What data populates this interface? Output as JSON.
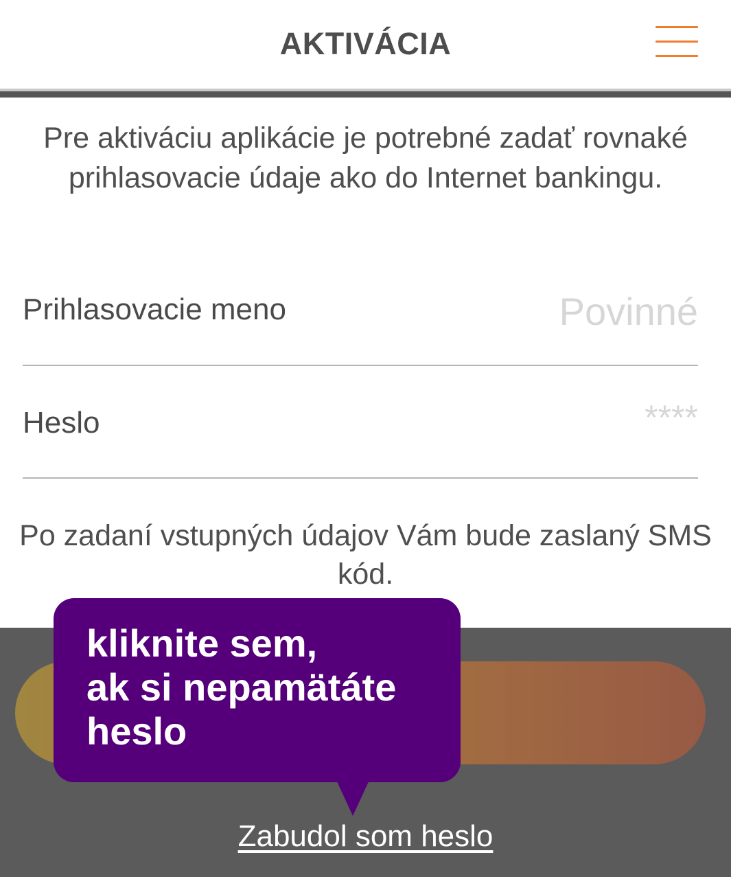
{
  "header": {
    "title": "AKTIVÁCIA",
    "menu_icon": "hamburger-menu-icon",
    "accent_color": "#f07c2e"
  },
  "intro": {
    "text": "Pre aktiváciu aplikácie je potrebné zadať rovnaké prihlasovacie údaje ako do Internet bankingu."
  },
  "form": {
    "username": {
      "label": "Prihlasovacie meno",
      "placeholder": "Povinné",
      "value": ""
    },
    "password": {
      "label": "Heslo",
      "placeholder": "****",
      "value": ""
    }
  },
  "sms_note": {
    "text": "Po zadaní vstupných údajov Vám bude zaslaný SMS kód."
  },
  "bottom": {
    "continue_button_label": "",
    "forgot_password_link": "Zabudol som heslo"
  },
  "tooltip": {
    "text": "kliknite sem,\nak si nepamätáte\nheslo",
    "color": "#55007a"
  }
}
